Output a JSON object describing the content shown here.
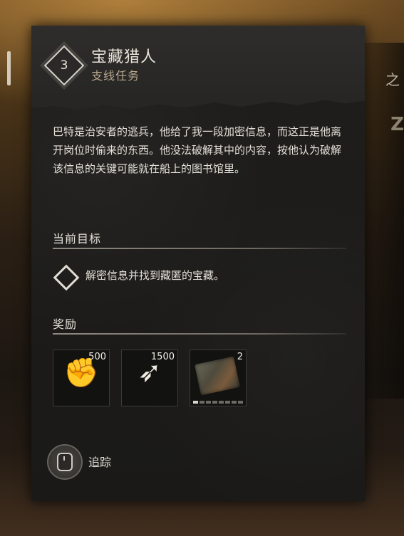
{
  "quest": {
    "number": "3",
    "title": "宝藏猎人",
    "subtitle": "支线任务",
    "description": "巴特是治安者的逃兵，他给了我一段加密信息，而这正是他离开岗位时偷来的东西。他没法破解其中的内容，按他认为破解该信息的关键可能就在船上的图书馆里。"
  },
  "objective": {
    "section_label": "当前目标",
    "text": "解密信息并找到藏匿的宝藏。"
  },
  "rewards": {
    "section_label": "奖励",
    "items": [
      {
        "icon": "fist-icon",
        "count": "500"
      },
      {
        "icon": "winged-boot-icon",
        "count": "1500"
      },
      {
        "icon": "crafting-material-icon",
        "count": "2",
        "durability_filled": 1,
        "durability_total": 8
      }
    ]
  },
  "actions": {
    "track_label": "追踪"
  },
  "side": {
    "right_glyph": "之",
    "right_glyph2": "Z"
  },
  "colors": {
    "panel_bg": "#1c1b1a",
    "subtitle": "#b9a98e",
    "text": "#e4e0d8"
  }
}
